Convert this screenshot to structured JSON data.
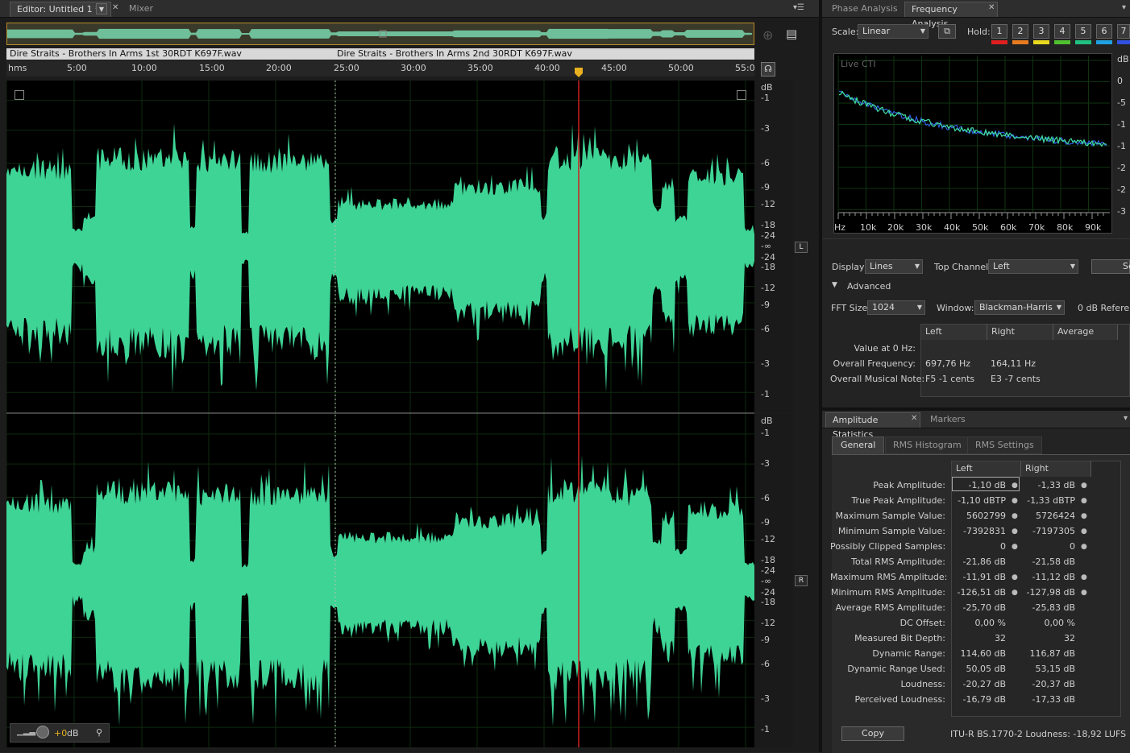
{
  "editor": {
    "tab_label": "Editor: Untitled 1 *",
    "mixer_tab": "Mixer",
    "clips": [
      {
        "name": "Dire Straits - Brothers In Arms 1st 30RDT K697F.wav"
      },
      {
        "name": "Dire Straits - Brothers In Arms 2nd 30RDT K697F.wav"
      }
    ],
    "ruler_labels": [
      "hms",
      "5:00",
      "10:00",
      "15:00",
      "20:00",
      "25:00",
      "30:00",
      "35:00",
      "40:00",
      "45:00",
      "50:00",
      "55:0"
    ],
    "db_labels_top": [
      "dB",
      "-1",
      "-3",
      "-6",
      "-9",
      "-12",
      "-18",
      "-24",
      "-∞",
      "-24",
      "-18",
      "-12",
      "-9",
      "-6",
      "-3",
      "-1"
    ],
    "db_labels_bottom": [
      "dB",
      "-1",
      "-3",
      "-6",
      "-9",
      "-12",
      "-18",
      "-24",
      "-∞",
      "-24",
      "-18",
      "-12",
      "-9",
      "-6",
      "-3",
      "-1"
    ],
    "channel_left": "L",
    "channel_right": "R",
    "volume_value": "+0",
    "volume_unit": "dB",
    "waveform_color": "#3ed496"
  },
  "phase_tab": "Phase Analysis",
  "freq": {
    "tab": "Frequency Analysis",
    "scale_label": "Scale:",
    "scale_value": "Linear",
    "hold_label": "Hold:",
    "hold_buttons": [
      "1",
      "2",
      "3",
      "4",
      "5",
      "6",
      "7"
    ],
    "hold_colors": [
      "#e02020",
      "#e87a20",
      "#e8d820",
      "#50c030",
      "#20c080",
      "#20a0e0",
      "#3050e0"
    ],
    "live_cti": "Live CTI",
    "y_labels": [
      "dB",
      "0",
      "-5",
      "-1",
      "-1",
      "-2",
      "-2",
      "-3"
    ],
    "x_labels": [
      "Hz",
      "10k",
      "20k",
      "30k",
      "40k",
      "50k",
      "60k",
      "70k",
      "80k",
      "90k"
    ],
    "display_label": "Display:",
    "display_value": "Lines",
    "top_channel_label": "Top Channel:",
    "top_channel_value": "Left",
    "settings_btn": "Se",
    "advanced_label": "Advanced",
    "fft_label": "FFT Size:",
    "fft_value": "1024",
    "window_label": "Window:",
    "window_value": "Blackman-Harris",
    "zero_db_ref": "0 dB Referen",
    "table_headers": [
      "Left",
      "Right",
      "Average"
    ],
    "rows": [
      {
        "label": "Value at 0 Hz:",
        "left": "",
        "right": ""
      },
      {
        "label": "Overall Frequency:",
        "left": "697,76 Hz",
        "right": "164,11 Hz"
      },
      {
        "label": "Overall Musical Note:",
        "left": "F5 -1 cents",
        "right": "E3 -7 cents"
      }
    ]
  },
  "amp": {
    "tab": "Amplitude Statistics",
    "markers_tab": "Markers",
    "subtabs": [
      "General",
      "RMS Histogram",
      "RMS Settings"
    ],
    "col_left": "Left",
    "col_right": "Right",
    "rows": [
      {
        "label": "Peak Amplitude:",
        "left": "-1,10 dB",
        "right": "-1,33 dB"
      },
      {
        "label": "True Peak Amplitude:",
        "left": "-1,10 dBTP",
        "right": "-1,33 dBTP"
      },
      {
        "label": "Maximum Sample Value:",
        "left": "5602799",
        "right": "5726424"
      },
      {
        "label": "Minimum Sample Value:",
        "left": "-7392831",
        "right": "-7197305"
      },
      {
        "label": "Possibly Clipped Samples:",
        "left": "0",
        "right": "0"
      },
      {
        "label": "Total RMS Amplitude:",
        "left": "-21,86 dB",
        "right": "-21,58 dB"
      },
      {
        "label": "Maximum RMS Amplitude:",
        "left": "-11,91 dB",
        "right": "-11,12 dB"
      },
      {
        "label": "Minimum RMS Amplitude:",
        "left": "-126,51 dB",
        "right": "-127,98 dB"
      },
      {
        "label": "Average RMS Amplitude:",
        "left": "-25,70 dB",
        "right": "-25,83 dB"
      },
      {
        "label": "DC Offset:",
        "left": "0,00 %",
        "right": "0,00 %"
      },
      {
        "label": "Measured Bit Depth:",
        "left": "32",
        "right": "32"
      },
      {
        "label": "Dynamic Range:",
        "left": "114,60 dB",
        "right": "116,87 dB"
      },
      {
        "label": "Dynamic Range Used:",
        "left": "50,05 dB",
        "right": "53,15 dB"
      },
      {
        "label": "Loudness:",
        "left": "-20,27 dB",
        "right": "-20,37 dB"
      },
      {
        "label": "Perceived Loudness:",
        "left": "-16,79 dB",
        "right": "-17,33 dB"
      }
    ],
    "copy_button": "Copy",
    "itu_loudness": "ITU-R BS.1770-2 Loudness: -18,92 LUFS"
  }
}
